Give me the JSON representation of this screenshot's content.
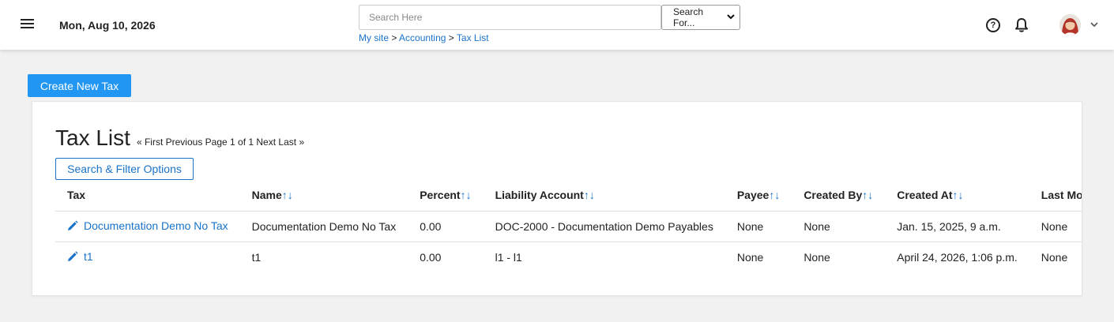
{
  "header": {
    "date": "Mon, Aug 10, 2026",
    "search_placeholder": "Search Here",
    "search_select": "Search For...",
    "breadcrumb": [
      {
        "label": "My site"
      },
      {
        "label": "Accounting"
      },
      {
        "label": "Tax List"
      }
    ],
    "breadcrumb_sep": ">"
  },
  "actions": {
    "create_label": "Create New Tax"
  },
  "list": {
    "title": "Tax List",
    "pager": {
      "first": "« First",
      "previous": "Previous",
      "page": "Page 1 of 1",
      "next": "Next",
      "last": "Last »"
    },
    "filter_label": "Search & Filter Options",
    "sort_arrows": "↑↓",
    "columns": [
      "Tax",
      "Name",
      "Percent",
      "Liability Account",
      "Payee",
      "Created By",
      "Created At",
      "Last Modified"
    ],
    "rows": [
      {
        "tax": "Documentation Demo No Tax",
        "name": "Documentation Demo No Tax",
        "percent": "0.00",
        "liability_account": "DOC-2000 - Documentation Demo Payables",
        "payee": "None",
        "created_by": "None",
        "created_at": "Jan. 15, 2025, 9 a.m.",
        "last_modified": "None"
      },
      {
        "tax": "t1",
        "name": "t1",
        "percent": "0.00",
        "liability_account": "l1 - l1",
        "payee": "None",
        "created_by": "None",
        "created_at": "April 24, 2026, 1:06 p.m.",
        "last_modified": "None"
      }
    ]
  },
  "colors": {
    "accent": "#2196f3",
    "link": "#1a73c8"
  },
  "icons": [
    "menu-icon",
    "help-icon",
    "bell-icon",
    "avatar",
    "chevron-down-icon",
    "pencil-icon"
  ]
}
